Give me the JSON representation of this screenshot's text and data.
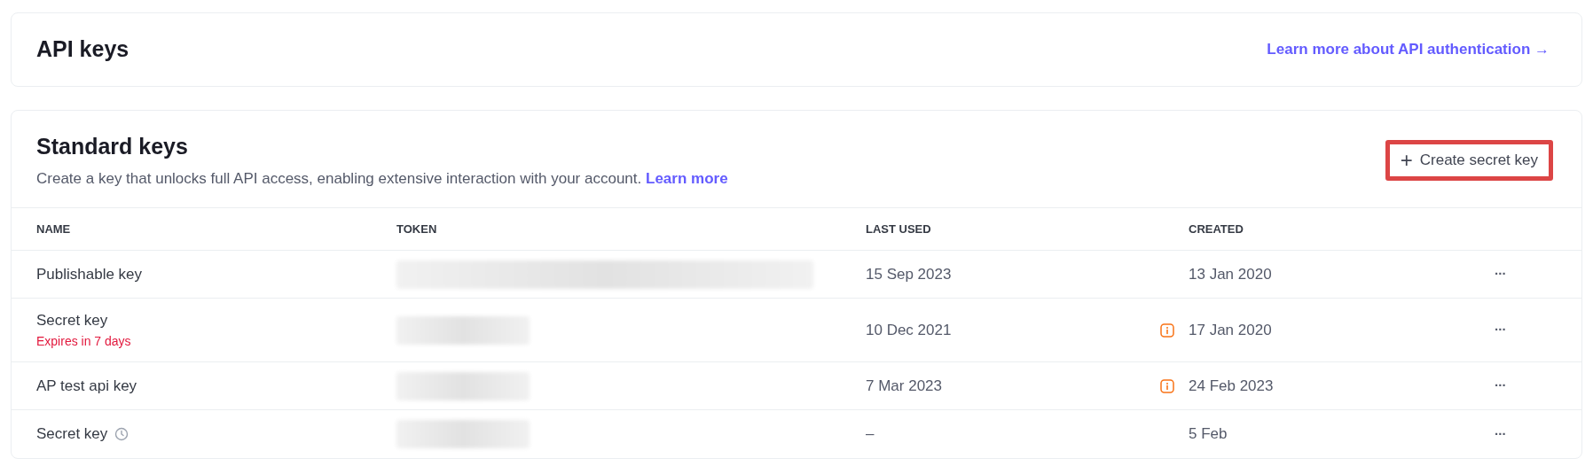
{
  "header": {
    "title": "API keys",
    "link": "Learn more about API authentication →"
  },
  "standard_keys": {
    "title": "Standard keys",
    "description": "Create a key that unlocks full API access, enabling extensive interaction with your account.",
    "description_link": "Learn more",
    "create_button": {
      "icon": "+",
      "label": "Create secret key",
      "highlighted": true
    },
    "table": {
      "columns": [
        "NAME",
        "TOKEN",
        "LAST USED",
        "CREATED"
      ],
      "rows": [
        {
          "name": "Publishable key",
          "clock": false,
          "token": {
            "kind": "long"
          },
          "last_used": "15 Sep 2023",
          "warning": false,
          "created": "13 Jan 2020",
          "menu": "···"
        },
        {
          "name": "Secret key",
          "clock": false,
          "expires": "Expires in 7 days",
          "token": {
            "kind": "short"
          },
          "last_used": "10 Dec 2021",
          "warning": true,
          "created": "17 Jan 2020",
          "menu": "···"
        },
        {
          "name": "AP test api key",
          "clock": false,
          "token": {
            "kind": "short"
          },
          "last_used": "7 Mar 2023",
          "warning": true,
          "created": "24 Feb 2023",
          "menu": "···"
        },
        {
          "name": "Secret key",
          "clock": true,
          "token": {
            "kind": "short"
          },
          "last_used": "–",
          "warning": false,
          "created": "5 Feb",
          "menu": "···"
        }
      ]
    }
  }
}
